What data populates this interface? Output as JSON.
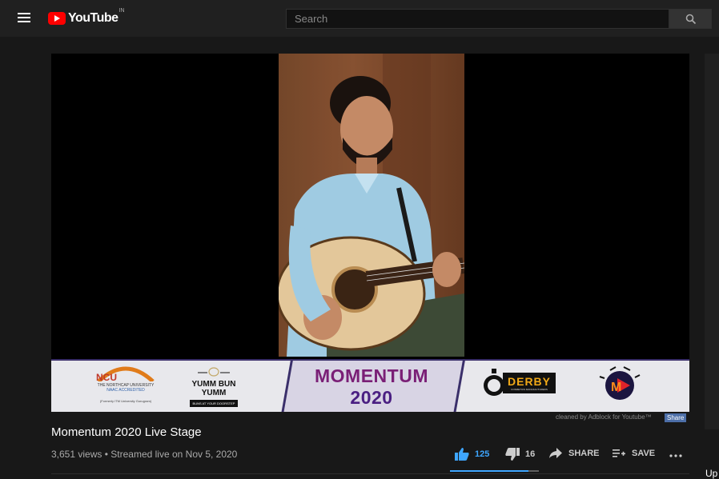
{
  "header": {
    "logo_text": "YouTube",
    "country_code": "IN",
    "search_placeholder": "Search"
  },
  "player": {
    "banner": {
      "title_line1": "MOMENTUM",
      "title_line2": "2020",
      "sponsors": [
        {
          "name": "NCU",
          "sub": "THE NORTHCAP UNIVERSITY",
          "note": "NAAC ACCREDITED",
          "footer": "(Formerly ITM University Gurugram)"
        },
        {
          "name": "YUMM BUN YUMM",
          "sub": "BUNS AT YOUR DOORSTEP"
        },
        {
          "name": "DERBY",
          "sub": "COSMETICS MANUFACTURERS"
        },
        {
          "name": "M"
        }
      ]
    },
    "adblock_note": "cleaned by Adblock for Youtube™",
    "share_small": "Share"
  },
  "video": {
    "title": "Momentum 2020 Live Stage",
    "views": "3,651 views",
    "streamed": "Streamed live on Nov 5, 2020"
  },
  "actions": {
    "likes": "125",
    "dislikes": "16",
    "share": "SHARE",
    "save": "SAVE",
    "like_ratio": 0.886
  },
  "sidebar": {
    "up_next_partial": "Up"
  },
  "colors": {
    "accent_blue": "#3ea6ff",
    "brand_red": "#ff0000",
    "banner_purple": "#7a1f76"
  }
}
